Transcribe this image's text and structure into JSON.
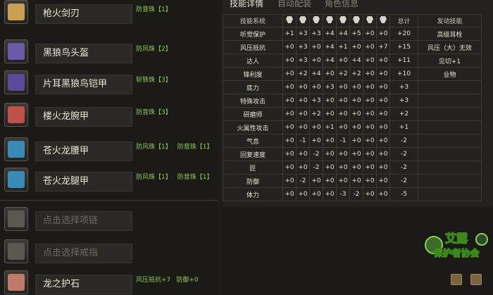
{
  "equipment": [
    {
      "name": "枪火剑刃",
      "decorations": [
        "防音珠【1】"
      ],
      "icon": "sword-icon",
      "color": "#c8a050",
      "empty": false
    },
    {
      "name": "黑狼鸟头盔",
      "decorations": [
        "防风珠【2】"
      ],
      "icon": "helmet-icon",
      "color": "#6a5aa8",
      "empty": false
    },
    {
      "name": "片耳黑狼鸟铠甲",
      "decorations": [
        "斩铁珠【3】"
      ],
      "icon": "chest-armor-icon",
      "color": "#5a4a9a",
      "empty": false
    },
    {
      "name": "楼火龙腕甲",
      "decorations": [
        "防音珠【3】"
      ],
      "icon": "gauntlet-icon",
      "color": "#c0504a",
      "empty": false
    },
    {
      "name": "苍火龙腰甲",
      "decorations": [
        "防风珠【1】",
        "防音珠【1】"
      ],
      "icon": "waist-armor-icon",
      "color": "#3a8ab8",
      "empty": false
    },
    {
      "name": "苍火龙腿甲",
      "decorations": [
        "防风珠【1】",
        "防音珠【1】"
      ],
      "icon": "leg-armor-icon",
      "color": "#3a8ab8",
      "empty": false
    },
    {
      "name": "点击选择项链",
      "decorations": [],
      "icon": "necklace-icon",
      "color": "#5a5850",
      "empty": true
    },
    {
      "name": "点击选择戒指",
      "decorations": [],
      "icon": "ring-icon",
      "color": "#5a5850",
      "empty": true
    },
    {
      "name": "龙之护石",
      "decorations": [
        "风压抵抗+7",
        "防御+0"
      ],
      "icon": "charm-icon",
      "color": "#c07a6a",
      "empty": false
    }
  ],
  "tabs": {
    "skill_detail": "技能详情",
    "auto_equip": "自动配装",
    "character_info": "角色信息"
  },
  "table": {
    "header_skill": "技能系统",
    "header_total": "总计",
    "header_active": "发动技能",
    "header_icons": [
      "weapon-icon",
      "head-icon",
      "chest-icon",
      "arm-icon",
      "waist-icon",
      "leg-icon",
      "necklace-icon",
      "ring-icon"
    ],
    "rows": [
      {
        "skill": "听觉保护",
        "vals": [
          "+1",
          "+3",
          "+3",
          "+4",
          "+4",
          "+5",
          "+0",
          "+0"
        ],
        "total": "+20",
        "active": "高级耳栓"
      },
      {
        "skill": "风压抵抗",
        "vals": [
          "+0",
          "+3",
          "+0",
          "+4",
          "+1",
          "+0",
          "+0",
          "+7"
        ],
        "total": "+15",
        "active": "风压（大）无效"
      },
      {
        "skill": "达人",
        "vals": [
          "+0",
          "+3",
          "+0",
          "+4",
          "+0",
          "+4",
          "+0",
          "+0"
        ],
        "total": "+11",
        "active": "见切+1"
      },
      {
        "skill": "锋利度",
        "vals": [
          "+0",
          "+2",
          "+4",
          "+0",
          "+2",
          "+2",
          "+0",
          "+0"
        ],
        "total": "+10",
        "active": "业物"
      },
      {
        "skill": "底力",
        "vals": [
          "+0",
          "+0",
          "+0",
          "+3",
          "+0",
          "+0",
          "+0",
          "+0"
        ],
        "total": "+3",
        "active": ""
      },
      {
        "skill": "特殊攻击",
        "vals": [
          "+0",
          "+0",
          "+3",
          "+0",
          "+0",
          "+0",
          "+0",
          "+0"
        ],
        "total": "+3",
        "active": ""
      },
      {
        "skill": "研磨师",
        "vals": [
          "+0",
          "+0",
          "+2",
          "+0",
          "+0",
          "+0",
          "+0",
          "+0"
        ],
        "total": "+2",
        "active": ""
      },
      {
        "skill": "火属性攻击",
        "vals": [
          "+0",
          "+0",
          "+0",
          "+1",
          "+0",
          "+0",
          "+0",
          "+0"
        ],
        "total": "+1",
        "active": ""
      },
      {
        "skill": "气息",
        "vals": [
          "+0",
          "-1",
          "+0",
          "+0",
          "-1",
          "+0",
          "+0",
          "+0"
        ],
        "total": "-2",
        "active": ""
      },
      {
        "skill": "回复速度",
        "vals": [
          "+0",
          "+0",
          "-2",
          "+0",
          "+0",
          "+0",
          "+0",
          "+0"
        ],
        "total": "-2",
        "active": ""
      },
      {
        "skill": "匠",
        "vals": [
          "+0",
          "+0",
          "-2",
          "+0",
          "+0",
          "+0",
          "+0",
          "+0"
        ],
        "total": "-2",
        "active": ""
      },
      {
        "skill": "防御",
        "vals": [
          "+0",
          "-2",
          "+0",
          "+0",
          "+0",
          "+0",
          "+0",
          "+0"
        ],
        "total": "-2",
        "active": ""
      },
      {
        "skill": "体力",
        "vals": [
          "+0",
          "+0",
          "+0",
          "+0",
          "-3",
          "-2",
          "+0",
          "+0"
        ],
        "total": "-5",
        "active": ""
      }
    ]
  },
  "logo_text": "艾露 保护者协会",
  "bottom_hint": "1"
}
